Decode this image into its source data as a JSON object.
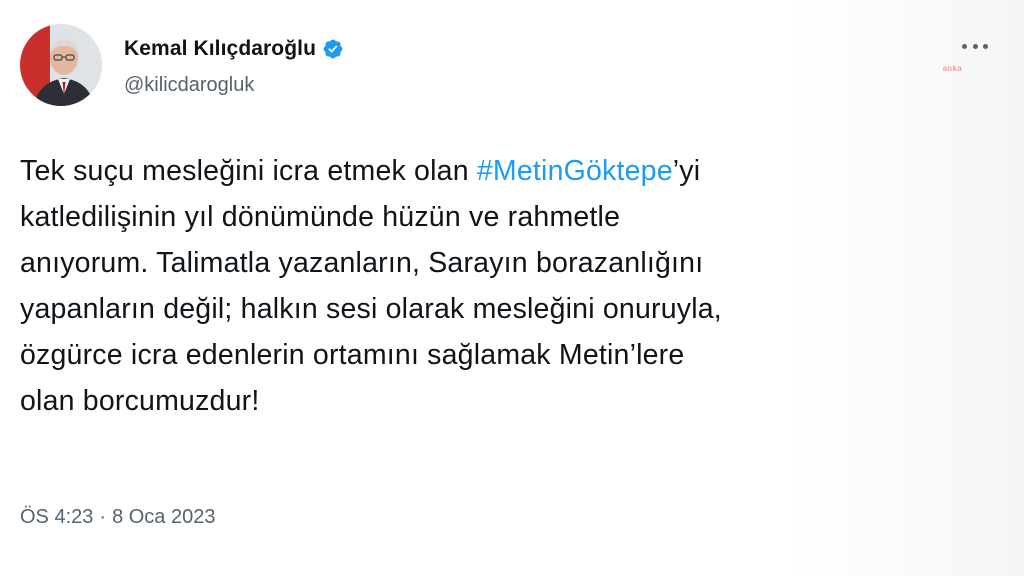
{
  "author": {
    "name": "Kemal Kılıçdaroğlu",
    "handle": "@kilicdarogluk",
    "verified": true,
    "avatar_icon": "profile-photo"
  },
  "watermark": "anka",
  "tweet": {
    "lines": [
      {
        "before": "Tek suçu mesleğini icra etmek olan ",
        "hashtag": "#MetinGöktepe",
        "after": "’yi"
      },
      {
        "text": "katledilişinin yıl dönümünde hüzün ve rahmetle"
      },
      {
        "text": "anıyorum. Talimatla yazanların, Sarayın borazanlığını"
      },
      {
        "text": "yapanların değil; halkın sesi olarak mesleğini onuruyla,"
      },
      {
        "text": "özgürce icra edenlerin ortamını sağlamak Metin’lere"
      },
      {
        "text": "olan borcumuzdur!"
      }
    ]
  },
  "meta": {
    "time": "ÖS 4:23",
    "separator": "·",
    "date": "8 Oca 2023"
  },
  "colors": {
    "text": "#0f1419",
    "secondary": "#536471",
    "link": "#1d9bf0",
    "verified": "#1d9bf0"
  },
  "icons": {
    "verified": "verified-badge-icon",
    "more": "more-options-icon"
  }
}
